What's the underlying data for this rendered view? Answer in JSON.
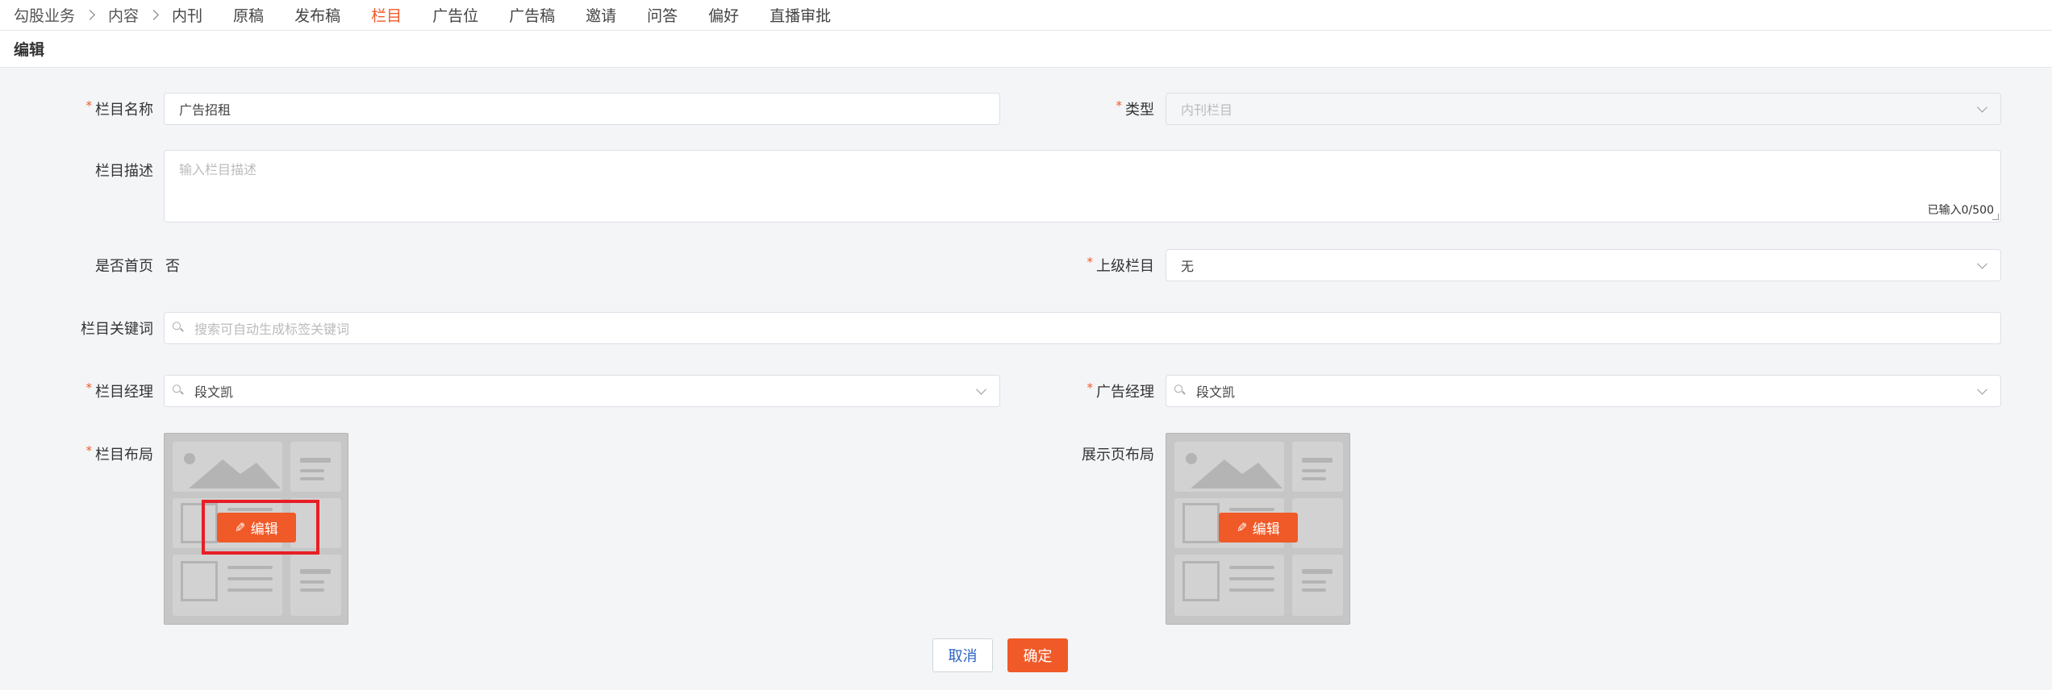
{
  "nav": {
    "breadcrumbs": [
      "勾股业务",
      "内容"
    ],
    "tabs": [
      {
        "label": "内刊",
        "active": false
      },
      {
        "label": "原稿",
        "active": false
      },
      {
        "label": "发布稿",
        "active": false
      },
      {
        "label": "栏目",
        "active": true
      },
      {
        "label": "广告位",
        "active": false
      },
      {
        "label": "广告稿",
        "active": false
      },
      {
        "label": "邀请",
        "active": false
      },
      {
        "label": "问答",
        "active": false
      },
      {
        "label": "偏好",
        "active": false
      },
      {
        "label": "直播审批",
        "active": false
      }
    ],
    "accent_color": "#f05a28"
  },
  "page_title": "编辑",
  "form": {
    "column_name": {
      "label": "栏目名称",
      "value": "广告招租",
      "required": true
    },
    "type": {
      "label": "类型",
      "placeholder": "内刊栏目",
      "required": true,
      "disabled": true
    },
    "description": {
      "label": "栏目描述",
      "placeholder": "输入栏目描述",
      "counter": "已输入0/500"
    },
    "is_home": {
      "label": "是否首页",
      "value": "否"
    },
    "parent": {
      "label": "上级栏目",
      "value": "无",
      "required": true
    },
    "keywords": {
      "label": "栏目关键词",
      "placeholder": "搜索可自动生成标签关键词"
    },
    "manager": {
      "label": "栏目经理",
      "value": "段文凯",
      "required": true
    },
    "ad_manager": {
      "label": "广告经理",
      "value": "段文凯",
      "required": true
    },
    "layout": {
      "label": "栏目布局",
      "required": true,
      "edit_label": "编辑"
    },
    "display_layout": {
      "label": "展示页布局",
      "edit_label": "编辑"
    }
  },
  "actions": {
    "cancel": "取消",
    "confirm": "确定"
  }
}
